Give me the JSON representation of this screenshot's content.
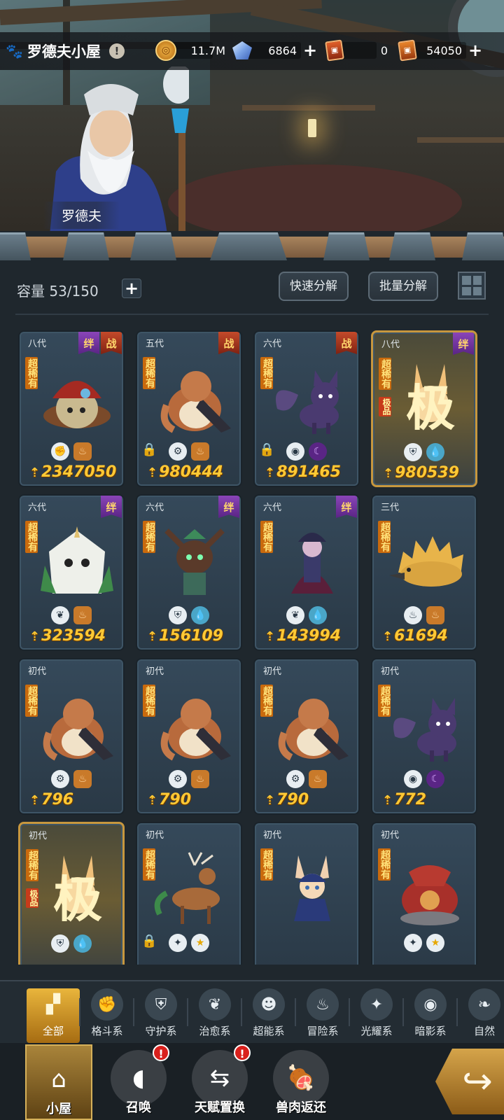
{
  "header": {
    "title": "罗德夫小屋",
    "npc_name": "罗德夫",
    "resources": [
      {
        "icon": "gold-coin-icon",
        "value": "11.7M",
        "has_plus": false
      },
      {
        "icon": "crystal-gem-icon",
        "value": "6864",
        "has_plus": true
      },
      {
        "icon": "red-ticket-icon",
        "value": "0",
        "has_plus": false
      },
      {
        "icon": "orange-ticket-icon",
        "value": "54050",
        "has_plus": true
      }
    ]
  },
  "storage": {
    "capacity_label": "容量 53/150",
    "quick_decompose": "快速分解",
    "batch_decompose": "批量分解"
  },
  "labels": {
    "rarity": "超稀有",
    "jipin": "极品",
    "ban": "绊",
    "zhan": "战",
    "power_icon": "⇡"
  },
  "cards": [
    {
      "gen": "八代",
      "badges": [
        "绊",
        "战"
      ],
      "power": "2347050",
      "locked": false,
      "traits": [
        "fist",
        "meat"
      ],
      "jipin": false,
      "gold": false,
      "creature": "mushroom-bird"
    },
    {
      "gen": "五代",
      "badges": [
        "战"
      ],
      "power": "980444",
      "locked": true,
      "traits": [
        "gear",
        "meat"
      ],
      "jipin": false,
      "gold": false,
      "creature": "platypus"
    },
    {
      "gen": "六代",
      "badges": [
        "战"
      ],
      "power": "891465",
      "locked": true,
      "traits": [
        "eye",
        "moon"
      ],
      "jipin": false,
      "gold": false,
      "creature": "fox"
    },
    {
      "gen": "八代",
      "badges": [
        "绊"
      ],
      "power": "980539",
      "locked": false,
      "traits": [
        "shield",
        "drop"
      ],
      "jipin": true,
      "gold": true,
      "creature": "rabbit-glow"
    },
    {
      "gen": "六代",
      "badges": [
        "绊"
      ],
      "power": "323594",
      "locked": false,
      "traits": [
        "sprout",
        "meat"
      ],
      "jipin": false,
      "gold": false,
      "creature": "owl"
    },
    {
      "gen": "六代",
      "badges": [
        "绊"
      ],
      "power": "156109",
      "locked": false,
      "traits": [
        "shield",
        "drop"
      ],
      "jipin": false,
      "gold": false,
      "creature": "tree-spirit"
    },
    {
      "gen": "六代",
      "badges": [
        "绊"
      ],
      "power": "143994",
      "locked": false,
      "traits": [
        "sprout",
        "drop"
      ],
      "jipin": false,
      "gold": false,
      "creature": "sorceress"
    },
    {
      "gen": "三代",
      "badges": [],
      "power": "61694",
      "locked": false,
      "traits": [
        "flame",
        "meat"
      ],
      "jipin": false,
      "gold": false,
      "creature": "hedgehog"
    },
    {
      "gen": "初代",
      "badges": [],
      "power": "796",
      "locked": false,
      "traits": [
        "gear",
        "meat"
      ],
      "jipin": false,
      "gold": false,
      "creature": "platypus"
    },
    {
      "gen": "初代",
      "badges": [],
      "power": "790",
      "locked": false,
      "traits": [
        "gear",
        "meat"
      ],
      "jipin": false,
      "gold": false,
      "creature": "platypus"
    },
    {
      "gen": "初代",
      "badges": [],
      "power": "790",
      "locked": false,
      "traits": [
        "gear",
        "meat"
      ],
      "jipin": false,
      "gold": false,
      "creature": "platypus"
    },
    {
      "gen": "初代",
      "badges": [],
      "power": "772",
      "locked": false,
      "traits": [
        "eye",
        "moon"
      ],
      "jipin": false,
      "gold": false,
      "creature": "fox"
    },
    {
      "gen": "初代",
      "badges": [],
      "power": "",
      "locked": false,
      "traits": [
        "shield",
        "drop"
      ],
      "jipin": true,
      "gold": true,
      "creature": "rabbit-glow"
    },
    {
      "gen": "初代",
      "badges": [],
      "power": "",
      "locked": true,
      "traits": [
        "star-cross",
        "sun"
      ],
      "jipin": false,
      "gold": false,
      "creature": "deer"
    },
    {
      "gen": "初代",
      "badges": [],
      "power": "",
      "locked": false,
      "traits": [],
      "jipin": false,
      "gold": false,
      "creature": "rabbit-girl"
    },
    {
      "gen": "初代",
      "badges": [],
      "power": "",
      "locked": false,
      "traits": [
        "star-cross",
        "sun"
      ],
      "jipin": false,
      "gold": false,
      "creature": "turtle-dragon"
    }
  ],
  "tabs": [
    {
      "label": "全部",
      "icon": "all-blocks-icon",
      "glyph": "▞",
      "active": true
    },
    {
      "label": "格斗系",
      "icon": "fist-icon",
      "glyph": "✊",
      "active": false
    },
    {
      "label": "守护系",
      "icon": "shield-icon",
      "glyph": "⛨",
      "active": false
    },
    {
      "label": "治愈系",
      "icon": "sprout-icon",
      "glyph": "❦",
      "active": false
    },
    {
      "label": "超能系",
      "icon": "alien-icon",
      "glyph": "☻",
      "active": false
    },
    {
      "label": "冒险系",
      "icon": "flame-icon",
      "glyph": "♨",
      "active": false
    },
    {
      "label": "光耀系",
      "icon": "star-cross-icon",
      "glyph": "✦",
      "active": false
    },
    {
      "label": "暗影系",
      "icon": "eye-icon",
      "glyph": "◉",
      "active": false
    },
    {
      "label": "自然",
      "icon": "leaf-icon",
      "glyph": "❧",
      "active": false
    }
  ],
  "bottom_nav": [
    {
      "label": "小屋",
      "icon": "hut-icon",
      "glyph": "⌂",
      "active": true,
      "alert": false
    },
    {
      "label": "召唤",
      "icon": "egg-icon",
      "glyph": "◖",
      "active": false,
      "alert": true
    },
    {
      "label": "天赋置换",
      "icon": "swap-arrows-icon",
      "glyph": "⇆",
      "active": false,
      "alert": true
    },
    {
      "label": "兽肉返还",
      "icon": "meat-icon",
      "glyph": "🍖",
      "active": false,
      "alert": false
    }
  ],
  "alert_glyph": "!",
  "go_glyph": "↪"
}
